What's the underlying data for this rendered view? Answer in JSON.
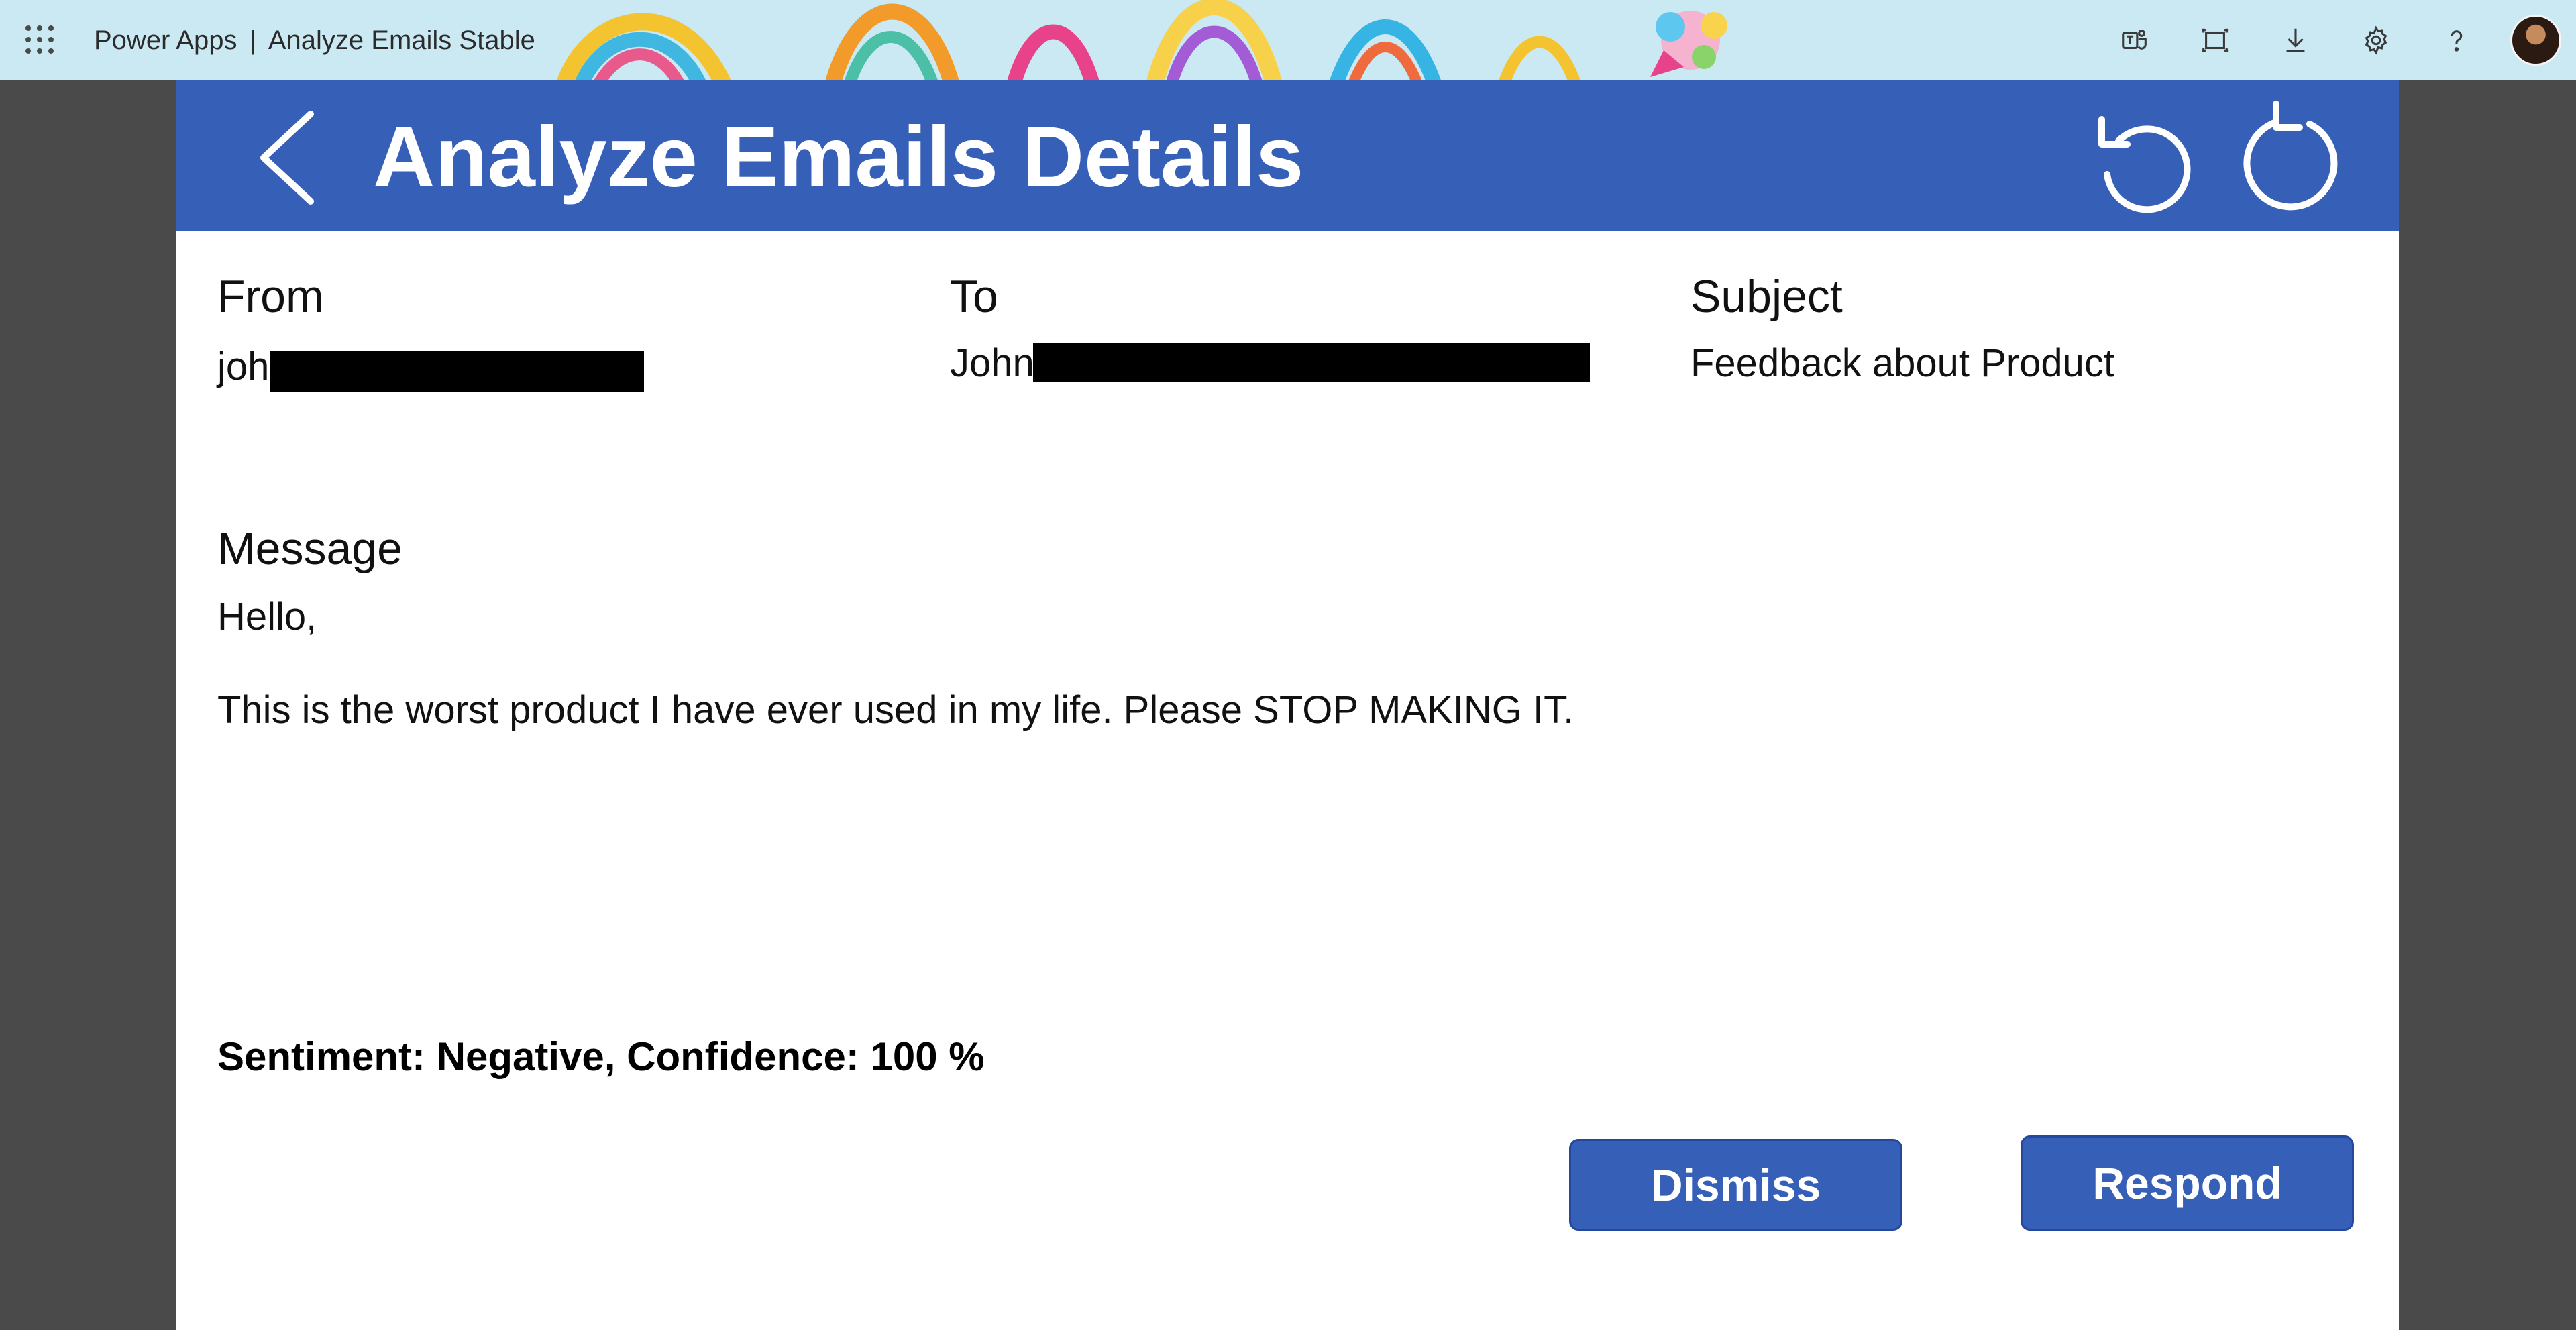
{
  "topbar": {
    "product": "Power Apps",
    "separator": "|",
    "app_name": "Analyze Emails Stable",
    "icons": [
      "waffle-icon",
      "teams-icon",
      "fit-to-screen-icon",
      "download-icon",
      "settings-icon",
      "help-icon",
      "user-avatar"
    ]
  },
  "header": {
    "title": "Analyze Emails Details",
    "icons": [
      "back-arrow-icon",
      "undo-icon",
      "refresh-icon"
    ],
    "background": "#365fb7"
  },
  "email": {
    "from_label": "From",
    "from_value": "joh",
    "to_label": "To",
    "to_value": "John",
    "subject_label": "Subject",
    "subject_value": "Feedback about Product",
    "message_label": "Message",
    "message_greeting": "Hello,",
    "message_body": "This is the worst product I have ever used in my life. Please STOP MAKING IT."
  },
  "sentiment": {
    "text": "Sentiment: Negative, Confidence: 100 %"
  },
  "actions": {
    "dismiss_label": "Dismiss",
    "respond_label": "Respond"
  },
  "colors": {
    "topbar": "#cbe9f3",
    "accent": "#365fb7",
    "outer_background": "#4a4a4a"
  }
}
